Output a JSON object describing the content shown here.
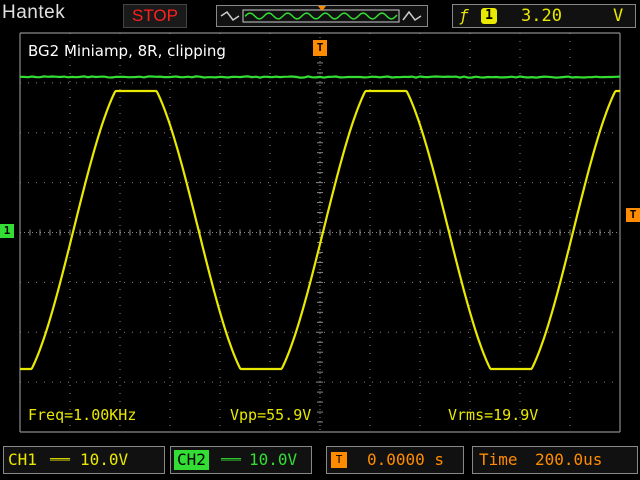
{
  "header": {
    "brand": "Hantek",
    "run_state": "STOP",
    "trigger": {
      "edge_icon": "rising-edge-icon",
      "channel": "1",
      "level": "3.20",
      "unit": "V"
    }
  },
  "screen": {
    "caption": "BG2 Miniamp, 8R, clipping",
    "trigger_marker": "T",
    "ch1_marker": "1",
    "ch2_level_marker": "",
    "measurements": {
      "freq": "Freq=1.00KHz",
      "vpp": "Vpp=55.9V",
      "vrms": "Vrms=19.9V"
    }
  },
  "footer": {
    "ch1_label": "CH1",
    "ch1_scale": "10.0V",
    "ch2_label": "CH2",
    "ch2_scale": "10.0V",
    "trigger_time": "0.0000 s",
    "time_label": "Time",
    "time_scale": "200.0us"
  },
  "colors": {
    "ch1": "#e8e800",
    "ch2": "#33dd33",
    "grid": "#8a8a8a",
    "stop": "#ff2020",
    "trigger": "#ff8c00"
  }
}
